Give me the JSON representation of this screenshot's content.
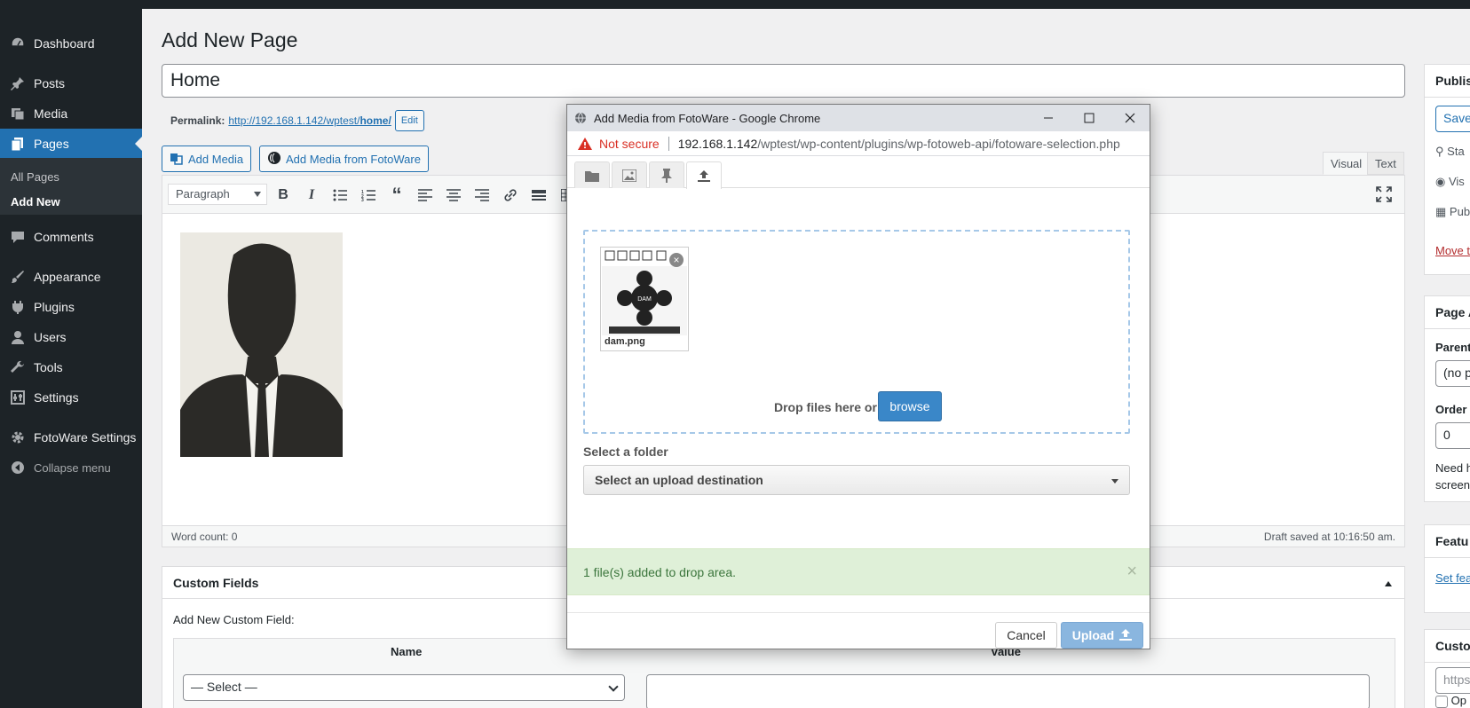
{
  "sidebar": {
    "items": [
      {
        "label": "Dashboard",
        "icon": "dashboard-icon"
      },
      {
        "label": "Posts",
        "icon": "pin-icon"
      },
      {
        "label": "Media",
        "icon": "media-icon"
      },
      {
        "label": "Pages",
        "icon": "pages-icon"
      },
      {
        "label": "Comments",
        "icon": "comments-icon"
      },
      {
        "label": "Appearance",
        "icon": "brush-icon"
      },
      {
        "label": "Plugins",
        "icon": "plugin-icon"
      },
      {
        "label": "Users",
        "icon": "user-icon"
      },
      {
        "label": "Tools",
        "icon": "wrench-icon"
      },
      {
        "label": "Settings",
        "icon": "settings-icon"
      },
      {
        "label": "FotoWare Settings",
        "icon": "gear-icon"
      }
    ],
    "submenu": [
      "All Pages",
      "Add New"
    ],
    "collapse": "Collapse menu"
  },
  "main": {
    "title": "Add New Page",
    "post_title": "Home",
    "permalink_label": "Permalink:",
    "permalink_url": "http://192.168.1.142/wptest/",
    "permalink_slug": "home/",
    "edit_label": "Edit",
    "add_media": "Add Media",
    "add_media_fotoware": "Add Media from FotoWare",
    "tab_visual": "Visual",
    "tab_text": "Text",
    "format": "Paragraph",
    "word_count": "Word count: 0",
    "draft_saved": "Draft saved at 10:16:50 am."
  },
  "custom_fields": {
    "title": "Custom Fields",
    "add_new": "Add New Custom Field:",
    "col_name": "Name",
    "col_value": "Value",
    "select": "— Select —"
  },
  "right": {
    "publish_title": "Publish",
    "save": "Save",
    "status": "Sta",
    "visibility": "Vis",
    "publish": "Pub",
    "move_trash": "Move t",
    "page_attr_title": "Page A",
    "parent": "Parent",
    "parent_value": "(no p",
    "order": "Order",
    "order_value": "0",
    "need_help": "Need h",
    "screen": "screen",
    "featured_title": "Featu",
    "set_featured": "Set fea",
    "custom_title": "Custo",
    "custom_input": "https",
    "custom_checkbox": "Op"
  },
  "popup": {
    "window_title": "Add Media from FotoWare - Google Chrome",
    "not_secure": "Not secure",
    "url_host": "192.168.1.142",
    "url_path": "/wptest/wp-content/plugins/wp-fotoweb-api/fotoware-selection.php",
    "tabs": [
      "folder-icon",
      "image-icon",
      "pin-icon",
      "upload-icon"
    ],
    "file_name": "dam.png",
    "drop_text": "Drop files here or",
    "browse": "browse",
    "folder_label": "Select a folder",
    "folder_placeholder": "Select an upload destination",
    "alert": "1 file(s) added to drop area.",
    "cancel": "Cancel",
    "upload": "Upload"
  },
  "colors": {
    "wp_blue": "#2271b1",
    "sidebar_bg": "#1d2327",
    "browse_blue": "#3a87c8",
    "alert_green_bg": "#dff0d8",
    "not_secure_red": "#d93025"
  }
}
